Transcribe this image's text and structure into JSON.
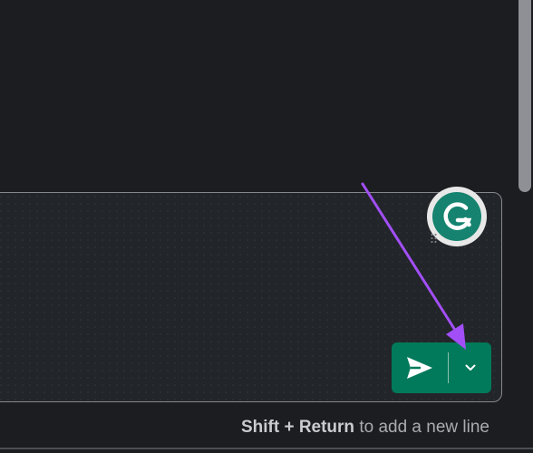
{
  "composer": {
    "hint_shortcut": "Shift + Return",
    "hint_text": " to add a new line"
  },
  "icons": {
    "grammarly": "grammarly-g-icon",
    "send": "paper-plane-send-icon",
    "options": "chevron-down-icon",
    "annotation": "purple-arrow-annotation"
  },
  "colors": {
    "background": "#1b1d21",
    "send_button": "#007a5a",
    "grammarly": "#15836f",
    "annotation_arrow": "#a24ff7"
  }
}
